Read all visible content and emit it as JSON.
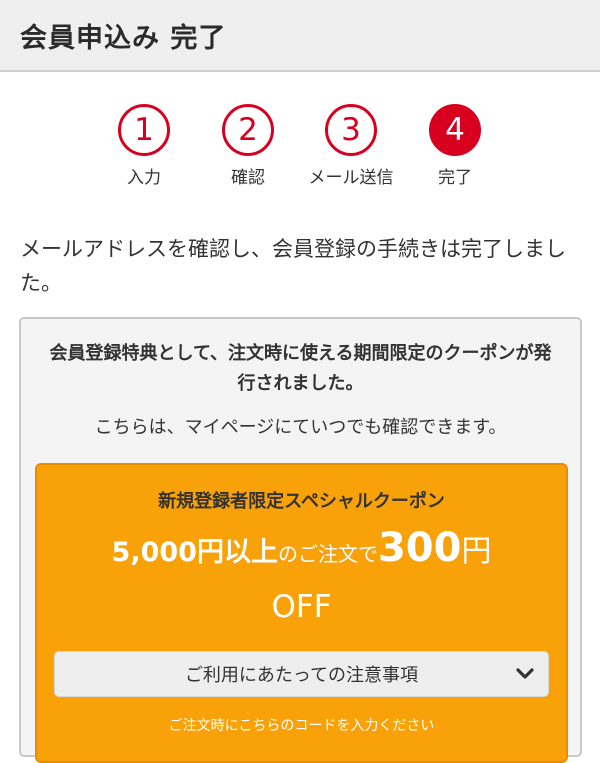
{
  "header": {
    "title": "会員申込み 完了"
  },
  "steps": [
    {
      "number": "1",
      "label": "入力",
      "active": false
    },
    {
      "number": "2",
      "label": "確認",
      "active": false
    },
    {
      "number": "3",
      "label": "メール送信",
      "active": false
    },
    {
      "number": "4",
      "label": "完了",
      "active": true
    }
  ],
  "message": "メールアドレスを確認し、会員登録の手続きは完了しました。",
  "benefit": {
    "title": "会員登録特典として、注文時に使える期間限定のクーポンが発行されました。",
    "note": "こちらは、マイページにていつでも確認できます。"
  },
  "coupon": {
    "name": "新規登録者限定スペシャルクーポン",
    "minimum": "5,000円以上",
    "text_1": "のご注文で",
    "amount": "300",
    "yen": "円",
    "off": "OFF",
    "notes_button_label": "ご利用にあたっての注意事項",
    "notes_icon": "chevron-down-icon",
    "code_hint": "ご注文時にこちらのコードを入力ください"
  },
  "colors": {
    "accent_red": "#d7001e",
    "coupon_orange": "#f9a108",
    "header_bg": "#efefef",
    "box_bg": "#f4f4f4"
  }
}
